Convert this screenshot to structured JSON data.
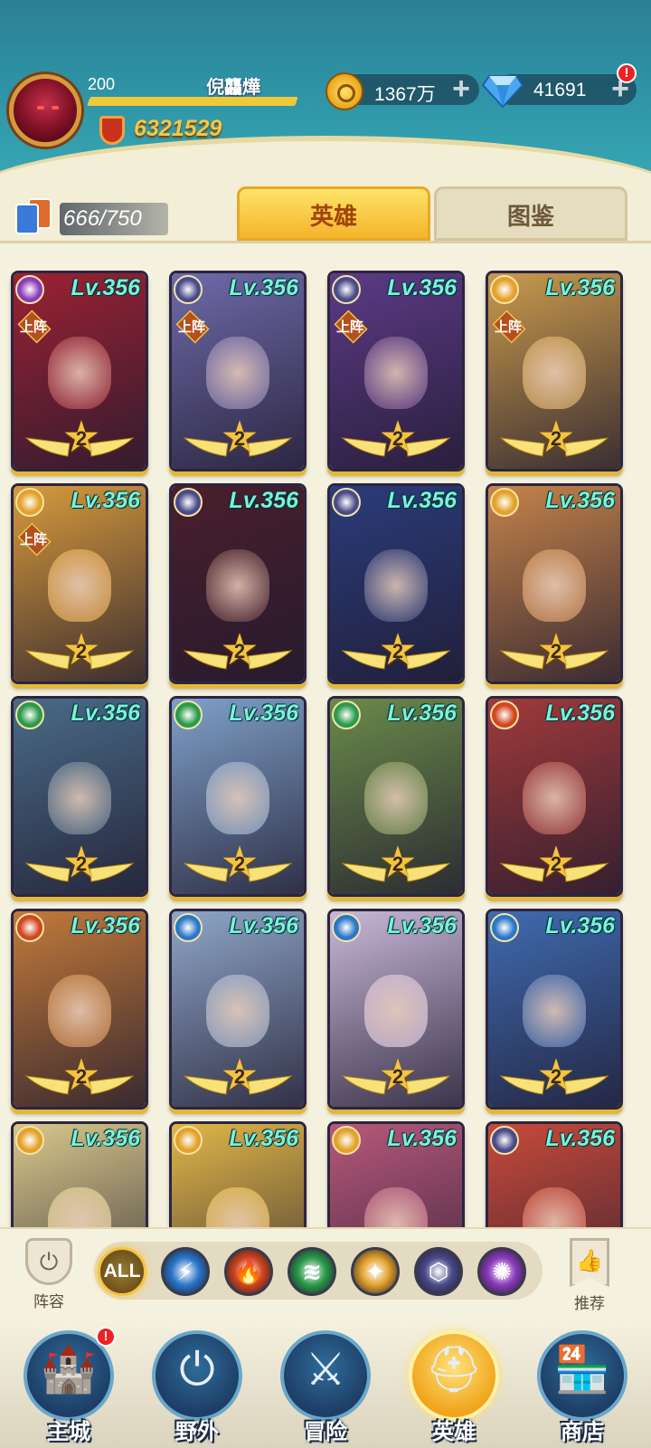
{
  "header": {
    "player_level": "200",
    "player_name": "倪龘燁",
    "combat_power": "6321529",
    "gold": "1367万",
    "gems": "41691",
    "gem_notice": "!",
    "plus": "+"
  },
  "collection": {
    "count": "666/750"
  },
  "tabs": {
    "heroes": "英雄",
    "dex": "图鉴"
  },
  "heroes": [
    {
      "level": "Lv.356",
      "stars": "2",
      "deployed": "上阵",
      "element": "arcane",
      "color": "#9b2233"
    },
    {
      "level": "Lv.356",
      "stars": "2",
      "deployed": "上阵",
      "element": "void",
      "color": "#6f6aa8"
    },
    {
      "level": "Lv.356",
      "stars": "2",
      "deployed": "上阵",
      "element": "void",
      "color": "#5c3a86"
    },
    {
      "level": "Lv.356",
      "stars": "2",
      "deployed": "上阵",
      "element": "light",
      "color": "#c99a4c"
    },
    {
      "level": "Lv.356",
      "stars": "2",
      "deployed": "上阵",
      "element": "light",
      "color": "#d79a3c"
    },
    {
      "level": "Lv.356",
      "stars": "2",
      "deployed": "",
      "element": "void",
      "color": "#4a1f2c"
    },
    {
      "level": "Lv.356",
      "stars": "2",
      "deployed": "",
      "element": "void",
      "color": "#2b3c7a"
    },
    {
      "level": "Lv.356",
      "stars": "2",
      "deployed": "",
      "element": "light",
      "color": "#c5834a"
    },
    {
      "level": "Lv.356",
      "stars": "2",
      "deployed": "",
      "element": "wind",
      "color": "#4a6b87"
    },
    {
      "level": "Lv.356",
      "stars": "2",
      "deployed": "",
      "element": "wind",
      "color": "#7fa0c8"
    },
    {
      "level": "Lv.356",
      "stars": "2",
      "deployed": "",
      "element": "wind",
      "color": "#6b8a4a"
    },
    {
      "level": "Lv.356",
      "stars": "2",
      "deployed": "",
      "element": "fire",
      "color": "#a13a3a"
    },
    {
      "level": "Lv.356",
      "stars": "2",
      "deployed": "",
      "element": "fire",
      "color": "#c27a3a"
    },
    {
      "level": "Lv.356",
      "stars": "2",
      "deployed": "",
      "element": "water",
      "color": "#8fa6c8"
    },
    {
      "level": "Lv.356",
      "stars": "2",
      "deployed": "",
      "element": "water",
      "color": "#c8b8d8"
    },
    {
      "level": "Lv.356",
      "stars": "2",
      "deployed": "",
      "element": "water",
      "color": "#3f6bb0"
    },
    {
      "level": "Lv.356",
      "stars": "",
      "deployed": "",
      "element": "light",
      "color": "#d8c88a"
    },
    {
      "level": "Lv.356",
      "stars": "",
      "deployed": "",
      "element": "light",
      "color": "#e0b648"
    },
    {
      "level": "Lv.356",
      "stars": "",
      "deployed": "",
      "element": "light",
      "color": "#b8587a"
    },
    {
      "level": "Lv.356",
      "stars": "",
      "deployed": "",
      "element": "void",
      "color": "#c84a3a"
    }
  ],
  "element_colors": {
    "arcane": "#8a3bb8",
    "void": "#4a4a8a",
    "light": "#e3a12a",
    "wind": "#2a9a4a",
    "fire": "#d2461e",
    "water": "#2a76c8"
  },
  "filters": {
    "lineup_label": "阵容",
    "all_label": "ALL",
    "recommend_label": "推荐",
    "elements": [
      "water",
      "fire",
      "wind",
      "light",
      "void",
      "arcane"
    ]
  },
  "nav": {
    "main_city": "主城",
    "wild": "野外",
    "adventure": "冒险",
    "heroes": "英雄",
    "shop": "商店",
    "main_city_notice": "!"
  }
}
